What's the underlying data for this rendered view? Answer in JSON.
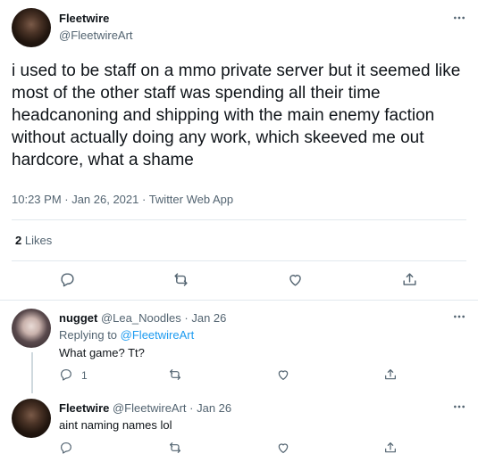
{
  "main_tweet": {
    "author_name": "Fleetwire",
    "author_handle": "@FleetwireArt",
    "text": "i used to be staff on a mmo private server but it seemed like most of the other staff was spending all their time headcanoning and shipping with the main enemy faction without actually doing any work, which skeeved me out hardcore, what a shame",
    "meta": "10:23 PM · Jan 26, 2021 · Twitter Web App",
    "like_count": "2",
    "like_label": "Likes"
  },
  "replies": [
    {
      "author_name": "nugget",
      "author_handle": "@Lea_Noodles",
      "date": "· Jan 26",
      "replying_label": "Replying to",
      "replying_to": "@FleetwireArt",
      "text": "What game? Tt?",
      "reply_count": "1"
    },
    {
      "author_name": "Fleetwire",
      "author_handle": "@FleetwireArt",
      "date": "· Jan 26",
      "text": "aint naming names lol"
    }
  ],
  "icons": {
    "reply": "reply-icon",
    "retweet": "retweet-icon",
    "like": "heart-icon",
    "share": "share-icon",
    "more": "more-icon"
  },
  "colors": {
    "link": "#1d9bf0",
    "secondary_text": "#536471",
    "divider": "#e1e8ed"
  }
}
